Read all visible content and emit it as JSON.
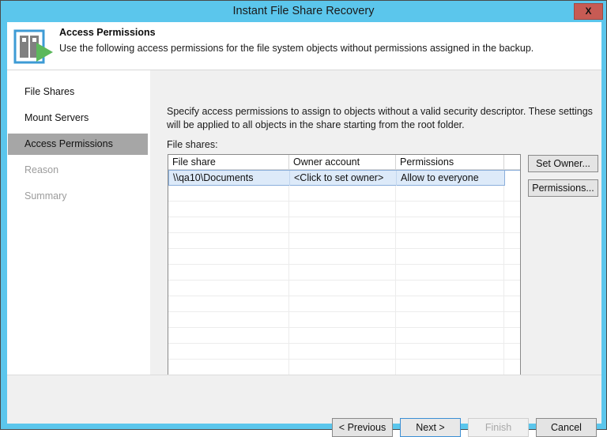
{
  "window": {
    "title": "Instant File Share Recovery",
    "close_label": "X",
    "chrome_color": "#5bc6ec",
    "close_button_color": "#c75b54"
  },
  "header": {
    "title": "Access Permissions",
    "description": "Use the following access permissions for the file system objects without permissions assigned in the backup.",
    "icon": "file-share-recovery-icon"
  },
  "sidebar": {
    "items": [
      {
        "label": "File Shares",
        "state": "done"
      },
      {
        "label": "Mount Servers",
        "state": "done"
      },
      {
        "label": "Access Permissions",
        "state": "active"
      },
      {
        "label": "Reason",
        "state": "disabled"
      },
      {
        "label": "Summary",
        "state": "disabled"
      }
    ],
    "active_background": "#a6a6a6"
  },
  "main": {
    "intro": "Specify access permissions to assign to objects without a valid security descriptor. These settings will be applied to all objects in the share starting from the root folder.",
    "fileshares_label": "File shares:",
    "table": {
      "columns": [
        "File share",
        "Owner account",
        "Permissions",
        ""
      ],
      "rows": [
        {
          "file_share": "\\\\qa10\\Documents",
          "owner_account": "<Click to set owner>",
          "permissions": "Allow to everyone",
          "filler": "",
          "selected": true
        }
      ],
      "empty_row_count": 13,
      "selection_color": "#ddeaf9"
    },
    "buttons": {
      "set_owner": "Set Owner...",
      "permissions": "Permissions..."
    }
  },
  "footer": {
    "previous": "< Previous",
    "next": "Next >",
    "finish": "Finish",
    "cancel": "Cancel",
    "default_button": "Next >",
    "disabled_button": "Finish",
    "focus_color": "#3b8fd4"
  }
}
